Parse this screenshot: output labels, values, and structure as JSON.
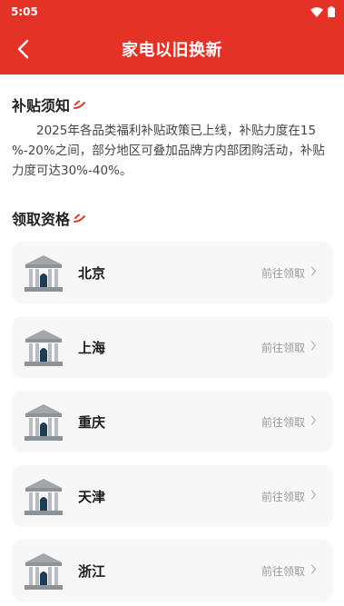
{
  "status_bar": {
    "time": "5:05"
  },
  "header": {
    "title": "家电以旧换新"
  },
  "notice": {
    "title": "补贴须知",
    "body": "2025年各品类福利补贴政策已上线，补贴力度在15 %-20%之间，部分地区可叠加品牌方内部团购活动，补贴力度可达30%-40%。"
  },
  "eligibility": {
    "title": "领取资格",
    "action_label": "前往领取",
    "regions": [
      "北京",
      "上海",
      "重庆",
      "天津",
      "浙江"
    ]
  },
  "colors": {
    "primary": "#e53227",
    "card_bg": "#f7f7f7"
  },
  "icons": {
    "back": "chevron-left-icon",
    "region": "government-building-icon",
    "action": "chevron-right-icon",
    "title_mark": "red-swoosh-icon"
  }
}
